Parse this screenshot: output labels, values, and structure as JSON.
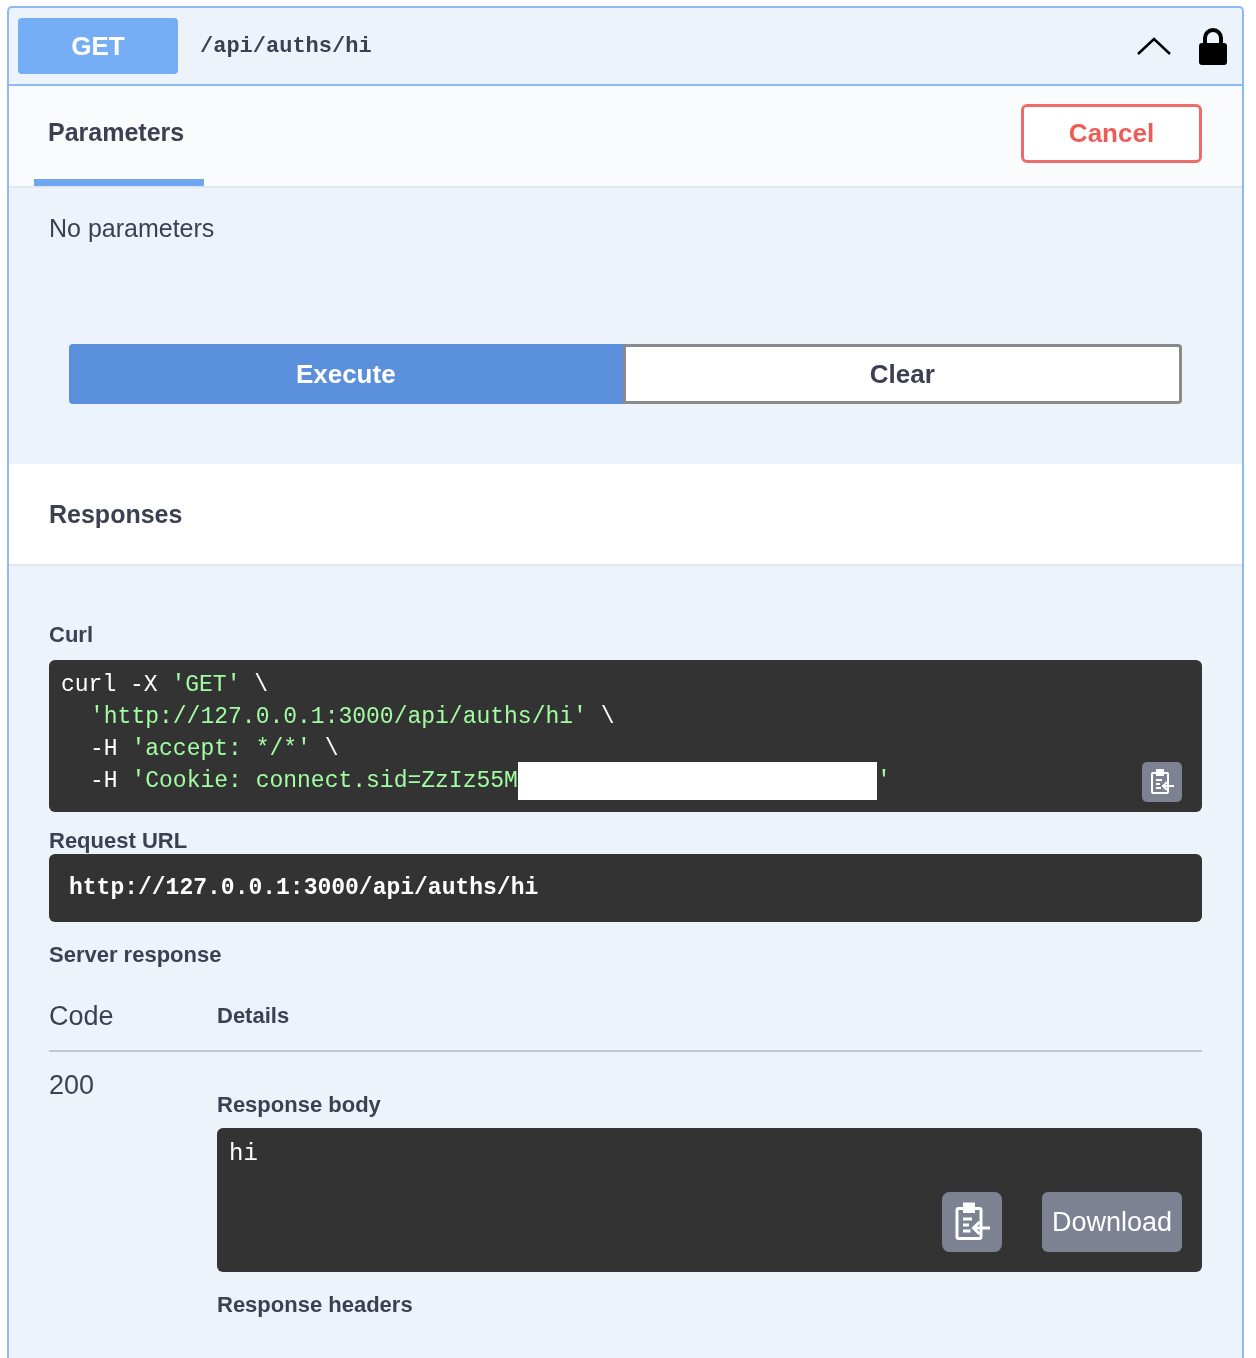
{
  "operation": {
    "method": "GET",
    "path": "/api/auths/hi",
    "expanded": true
  },
  "tabs": [
    {
      "label": "Parameters",
      "selected": true
    }
  ],
  "cancel_button": "Cancel",
  "parameters_message": "No parameters",
  "actions": [
    {
      "label": "Execute",
      "kind": "primary"
    },
    {
      "label": "Clear",
      "kind": "secondary"
    }
  ],
  "responses_title": "Responses",
  "curl": {
    "label": "Curl",
    "lines": [
      {
        "indent": false,
        "parts": [
          {
            "kind": "plain",
            "text": "curl -X "
          },
          {
            "kind": "string",
            "text": "'GET'"
          },
          {
            "kind": "plain",
            "text": " \\"
          }
        ]
      },
      {
        "indent": true,
        "parts": [
          {
            "kind": "string",
            "text": "'http://127.0.0.1:3000/api/auths/hi'"
          },
          {
            "kind": "plain",
            "text": " \\"
          }
        ]
      },
      {
        "indent": true,
        "parts": [
          {
            "kind": "plain",
            "text": "-H "
          },
          {
            "kind": "string",
            "text": "'accept: */*'"
          },
          {
            "kind": "plain",
            "text": " \\"
          }
        ]
      },
      {
        "indent": true,
        "parts": [
          {
            "kind": "plain",
            "text": "-H "
          },
          {
            "kind": "string",
            "text": "'Cookie: connect.sid=ZzIz55M"
          },
          {
            "kind": "redacted"
          },
          {
            "kind": "string",
            "text": "'"
          }
        ]
      }
    ]
  },
  "request_url": {
    "label": "Request URL",
    "value": "http://127.0.0.1:3000/api/auths/hi"
  },
  "server_response": {
    "label": "Server response",
    "columns": [
      "Code",
      "Details"
    ],
    "rows": [
      {
        "code": "200",
        "body_label": "Response body",
        "body": "hi",
        "download": "Download",
        "headers_label": "Response headers"
      }
    ]
  }
}
